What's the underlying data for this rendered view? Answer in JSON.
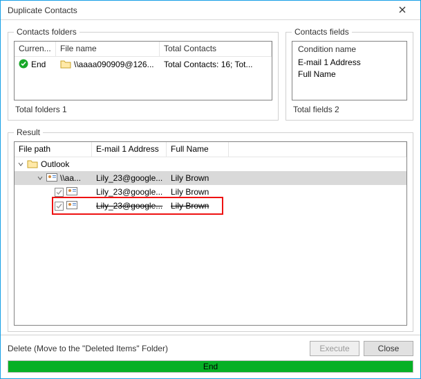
{
  "window": {
    "title": "Duplicate Contacts"
  },
  "folders": {
    "legend": "Contacts folders",
    "cols": {
      "c0": "Curren...",
      "c1": "File name",
      "c2": "Total Contacts"
    },
    "row": {
      "status": "End",
      "filename": "\\\\aaaa090909@126...",
      "totals": "Total Contacts: 16; Tot..."
    },
    "summary": "Total folders  1"
  },
  "fields": {
    "legend": "Contacts fields",
    "header": "Condition name",
    "items": {
      "i0": "E-mail 1 Address",
      "i1": "Full Name"
    },
    "summary": "Total fields  2"
  },
  "result": {
    "legend": "Result",
    "cols": {
      "c0": "File path",
      "c1": "E-mail 1 Address",
      "c2": "Full Name"
    },
    "rootLabel": "Outlook",
    "subLabel": "\\\\aa...",
    "rows": [
      {
        "email": "Lily_23@google...",
        "name": "Lily Brown"
      },
      {
        "email": "Lily_23@google...",
        "name": "Lily Brown"
      },
      {
        "email": "Lily_23@google...",
        "name": "Lily Brown"
      }
    ]
  },
  "footer": {
    "action": "Delete (Move to the \"Deleted Items\" Folder)",
    "execute": "Execute",
    "close": "Close",
    "progressText": "End",
    "progressPct": 100
  }
}
